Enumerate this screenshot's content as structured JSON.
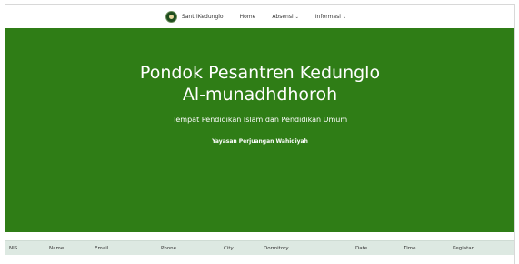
{
  "navbar": {
    "brand": "SantriKedunglo",
    "links": [
      {
        "label": "Home"
      },
      {
        "label": "Absensi",
        "caret": "⌄"
      },
      {
        "label": "Informasi",
        "caret": "⌄"
      }
    ]
  },
  "hero": {
    "title": "Pondok Pesantren Kedunglo Al-munadhdhoroh",
    "subtitle": "Tempat Pendidikan Islam dan Pendidikan Umum",
    "org": "Yayasan Perjuangan Wahidiyah",
    "background": "#2f7d16"
  },
  "table": {
    "header_bg": "#dde9e2",
    "columns": [
      "NIS",
      "Name",
      "Email",
      "Phone",
      "City",
      "Dormitory",
      "Date",
      "Time",
      "Kegiatan"
    ]
  }
}
